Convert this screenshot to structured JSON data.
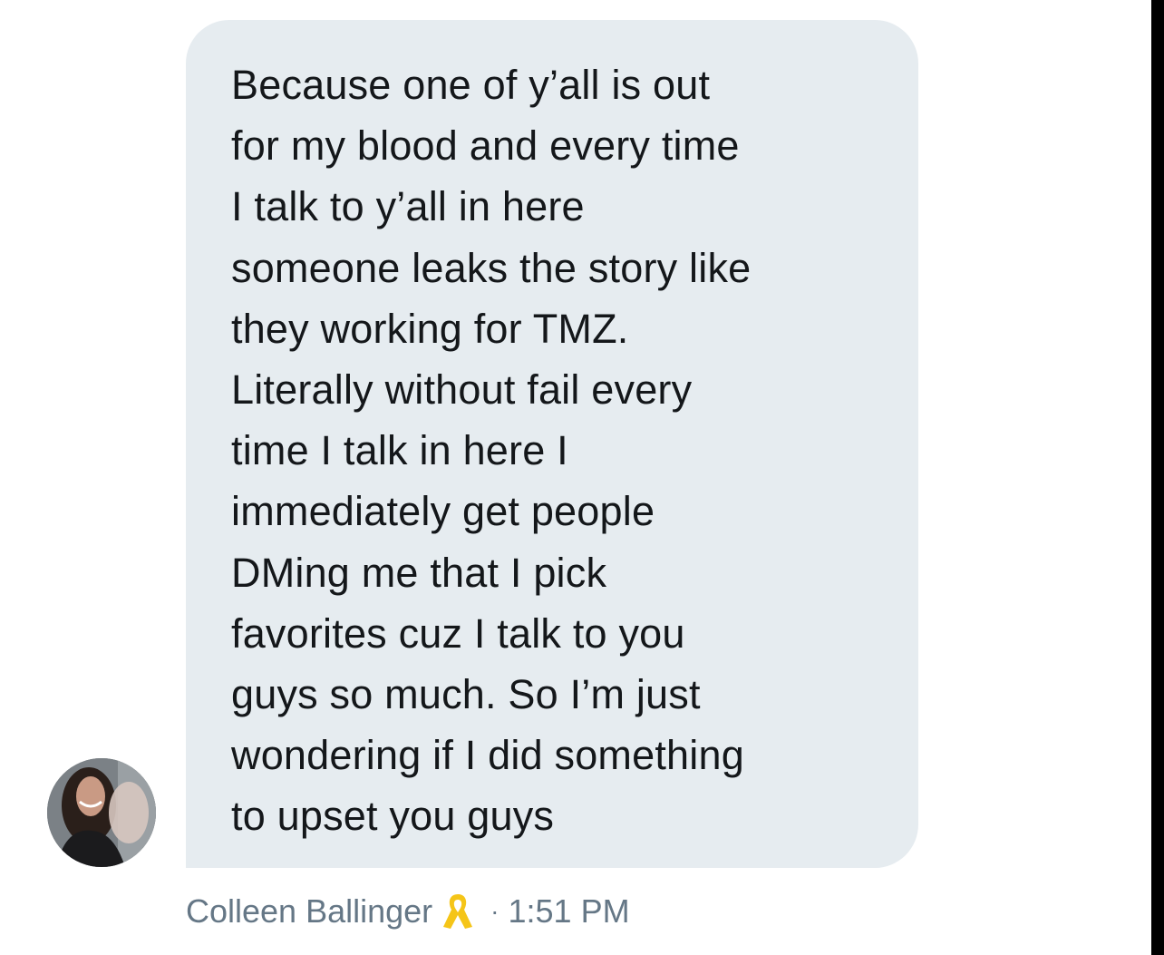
{
  "message": {
    "lines": [
      "Because one of y’all is out",
      "for my blood and every time",
      "I talk to y’all in here",
      "someone leaks the story like",
      "they working for TMZ.",
      "Literally without fail every",
      "time I talk in here I",
      "immediately get people",
      "DMing me that I pick",
      "favorites cuz I talk to you",
      "guys so much. So I’m just",
      "wondering if I did something",
      "to upset you guys"
    ],
    "bubble_color": "#e6ecf0",
    "text_color": "#14171a"
  },
  "sender": {
    "name": "Colleen Ballinger",
    "badge_icon": "yellow-ribbon-icon",
    "separator": "·",
    "time": "1:51 PM",
    "meta_color": "#657786",
    "ribbon_color": "#f5c518"
  }
}
